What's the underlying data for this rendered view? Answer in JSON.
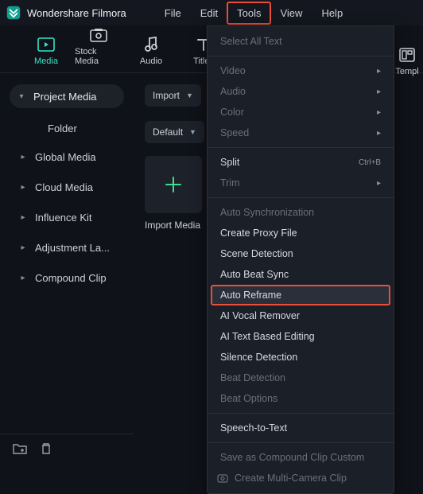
{
  "app_name": "Wondershare Filmora",
  "menubar": {
    "file": "File",
    "edit": "Edit",
    "tools": "Tools",
    "view": "View",
    "help": "Help"
  },
  "tabs": {
    "media": "Media",
    "stock_media": "Stock Media",
    "audio": "Audio",
    "titles": "Titles",
    "templates": "Templ"
  },
  "import_btn": "Import",
  "sort_btn": "Default",
  "sidebar": {
    "project_media": "Project Media",
    "folder": "Folder",
    "global_media": "Global Media",
    "cloud_media": "Cloud Media",
    "influence_kit": "Influence Kit",
    "adjustment_layer": "Adjustment La...",
    "compound_clip": "Compound Clip"
  },
  "add_card_label": "Import Media",
  "tools_menu": {
    "select_all_text": "Select All Text",
    "video": "Video",
    "audio": "Audio",
    "color": "Color",
    "speed": "Speed",
    "split": "Split",
    "split_shortcut": "Ctrl+B",
    "trim": "Trim",
    "auto_sync": "Auto Synchronization",
    "create_proxy": "Create Proxy File",
    "scene_detection": "Scene Detection",
    "auto_beat_sync": "Auto Beat Sync",
    "auto_reframe": "Auto Reframe",
    "ai_vocal_remover": "AI Vocal Remover",
    "ai_text_editing": "AI Text Based Editing",
    "silence_detection": "Silence Detection",
    "beat_detection": "Beat Detection",
    "beat_options": "Beat Options",
    "speech_to_text": "Speech-to-Text",
    "save_compound": "Save as Compound Clip Custom",
    "multi_camera": "Create Multi-Camera Clip"
  }
}
